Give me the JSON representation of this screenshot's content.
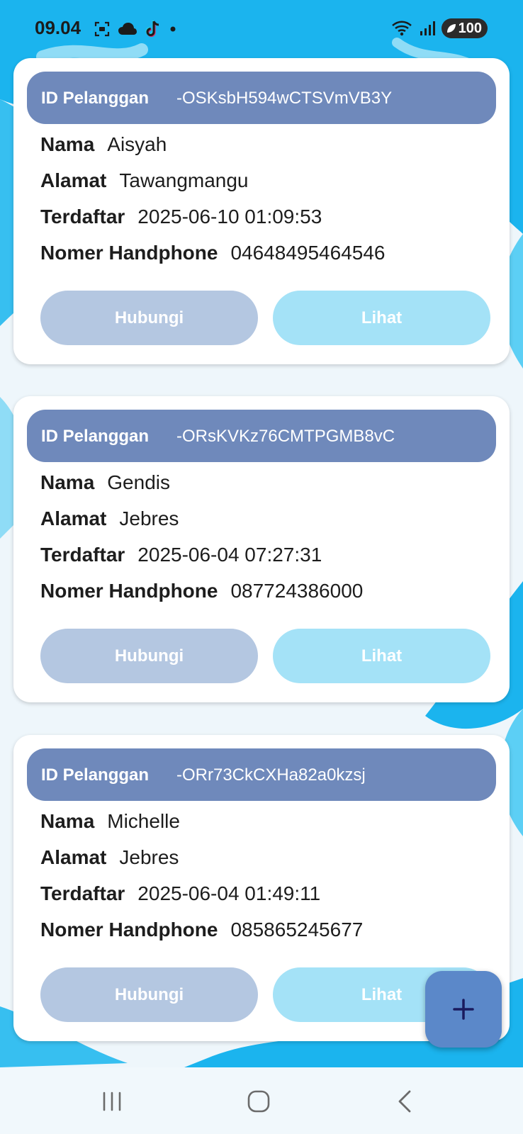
{
  "status_bar": {
    "time": "09.04",
    "battery": "100"
  },
  "customers": [
    {
      "id_label": "ID Pelanggan",
      "id_value": "-OSKsbH594wCTSVmVB3Y",
      "name_label": "Nama",
      "name": "Aisyah",
      "address_label": "Alamat",
      "address": "Tawangmangu",
      "registered_label": "Terdaftar",
      "registered": "2025-06-10 01:09:53",
      "phone_label": "Nomer Handphone",
      "phone": "04648495464546",
      "contact_button": "Hubungi",
      "view_button": "Lihat"
    },
    {
      "id_label": "ID Pelanggan",
      "id_value": "-ORsKVKz76CMTPGMB8vC",
      "name_label": "Nama",
      "name": "Gendis",
      "address_label": "Alamat",
      "address": "Jebres",
      "registered_label": "Terdaftar",
      "registered": "2025-06-04 07:27:31",
      "phone_label": "Nomer Handphone",
      "phone": "087724386000",
      "contact_button": "Hubungi",
      "view_button": "Lihat"
    },
    {
      "id_label": "ID Pelanggan",
      "id_value": "-ORr73CkCXHa82a0kzsj",
      "name_label": "Nama",
      "name": "Michelle",
      "address_label": "Alamat",
      "address": "Jebres",
      "registered_label": "Terdaftar",
      "registered": "2025-06-04 01:49:11",
      "phone_label": "Nomer Handphone",
      "phone": "085865245677",
      "contact_button": "Hubungi",
      "view_button": "Lihat"
    }
  ],
  "fab": {
    "icon": "plus-icon"
  },
  "colors": {
    "header": "#6f89bb",
    "contact_button": "#b4c7e1",
    "view_button": "#a4e2f7",
    "fab": "#5b88c9",
    "background_accent": "#1bb4ee"
  }
}
